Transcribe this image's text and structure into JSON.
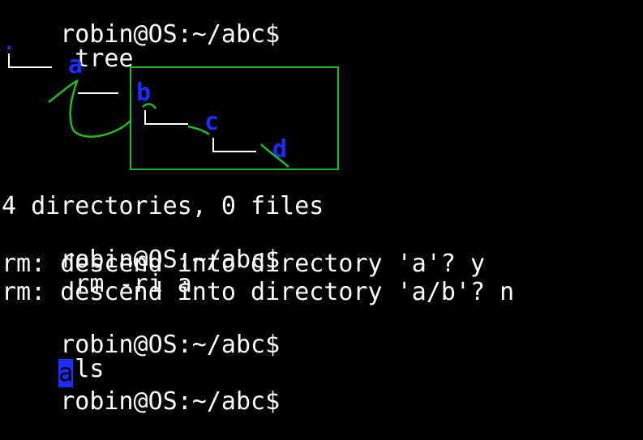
{
  "prompt": "robin@OS:~/abc$",
  "commands": {
    "tree": "tree",
    "rm": "rm -ri a",
    "ls": "ls"
  },
  "tree": {
    "root": ".",
    "nodes": [
      "a",
      "b",
      "c",
      "d"
    ]
  },
  "output": {
    "summary": "4 directories, 0 files",
    "rm_prompt_1": "rm: descend into directory 'a'? y",
    "rm_prompt_2": "rm: descend into directory 'a/b'? n",
    "ls_result": "a"
  },
  "colors": {
    "background": "#000000",
    "text": "#ffffff",
    "directory": "#1a2cff",
    "annotation": "#22bb22"
  }
}
